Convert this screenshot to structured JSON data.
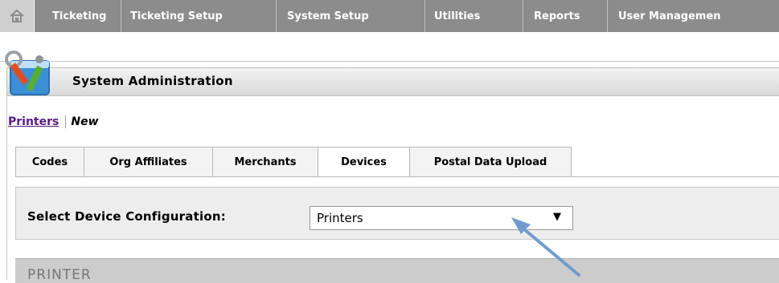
{
  "topnav": {
    "home_icon": "home-icon",
    "items": [
      {
        "label": "Ticketing"
      },
      {
        "label": "Ticketing Setup"
      },
      {
        "label": "System Setup"
      },
      {
        "label": "Utilities"
      },
      {
        "label": "Reports"
      },
      {
        "label": "User Managemen"
      }
    ]
  },
  "panel": {
    "title": "System Administration",
    "icon": "admin-tools-icon"
  },
  "breadcrumb": {
    "link": "Printers",
    "current": "New"
  },
  "tabs": [
    {
      "label": "Codes"
    },
    {
      "label": "Org Affiliates"
    },
    {
      "label": "Merchants"
    },
    {
      "label": "Devices",
      "active": true
    },
    {
      "label": "Postal Data Upload"
    }
  ],
  "device_config": {
    "label": "Select Device Configuration:",
    "selected": "Printers",
    "arrow": "▼"
  },
  "section": {
    "title": "PRINTER"
  },
  "colors": {
    "nav_bg": "#8c8c8c",
    "link": "#5a1a8a",
    "annotation_arrow": "#6f9bd1"
  }
}
